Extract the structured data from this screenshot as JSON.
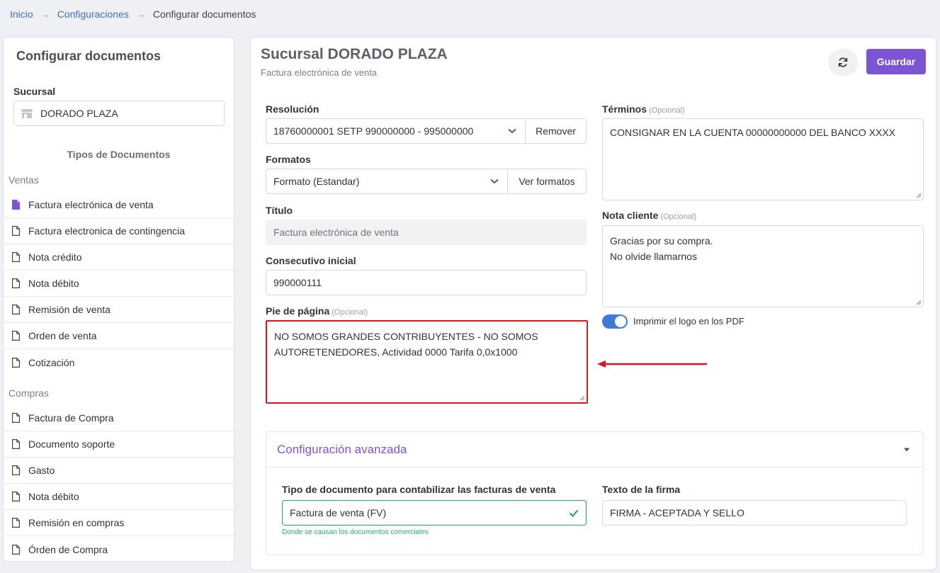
{
  "breadcrumb": {
    "home": "Inicio",
    "config": "Configuraciones",
    "current": "Configurar documentos"
  },
  "sidebar": {
    "title": "Configurar documentos",
    "sucursal_label": "Sucursal",
    "sucursal_value": "DORADO PLAZA",
    "tipos_heading": "Tipos de Documentos",
    "ventas_title": "Ventas",
    "ventas": [
      "Factura electrónica de venta",
      "Factura electronica de contingencia",
      "Nota crédito",
      "Nota débito",
      "Remisión de venta",
      "Orden de venta",
      "Cotización"
    ],
    "compras_title": "Compras",
    "compras": [
      "Factura de Compra",
      "Documento soporte",
      "Gasto",
      "Nota débito",
      "Remisión en compras",
      "Órden de Compra"
    ]
  },
  "main": {
    "title": "Sucursal DORADO PLAZA",
    "subtitle": "Factura electrónica de venta",
    "save_label": "Guardar",
    "optional": "(Opcional)",
    "resolucion": {
      "label": "Resolución",
      "value": "18760000001 SETP 990000000 - 995000000",
      "remove": "Remover"
    },
    "formatos": {
      "label": "Formatos",
      "value": "Formato (Estandar)",
      "view": "Ver formatos"
    },
    "titulo": {
      "label": "Título",
      "value": "Factura electrónica de venta"
    },
    "consecutivo": {
      "label": "Consecutivo inicial",
      "value": "990000111"
    },
    "pie": {
      "label": "Pie de página",
      "value": "NO SOMOS GRANDES CONTRIBUYENTES - NO SOMOS\nAUTORETENEDORES, Actividad 0000 Tarifa 0,0x1000"
    },
    "terminos": {
      "label": "Términos",
      "value": "CONSIGNAR EN LA CUENTA 00000000000 DEL BANCO XXXX"
    },
    "nota_cliente": {
      "label": "Nota cliente",
      "value": "Gracias por su compra.\nNo olvide llamarnos"
    },
    "logo_toggle": {
      "label": "Imprimir el logo en los PDF",
      "on": true
    },
    "advanced": {
      "title": "Configuración avanzada",
      "tipo_doc_label": "Tipo de documento para contabilizar las facturas de venta",
      "tipo_doc_value": "Factura de venta (FV)",
      "tipo_doc_hint": "Donde se causan los documentos comerciales",
      "firma_label": "Texto de la firma",
      "firma_value": "FIRMA - ACEPTADA Y SELLO"
    }
  },
  "colors": {
    "accent": "#7b55d3",
    "link": "#3f6fb5",
    "highlight": "#e0141b",
    "success": "#27a56b",
    "toggle": "#3d7bd6"
  }
}
